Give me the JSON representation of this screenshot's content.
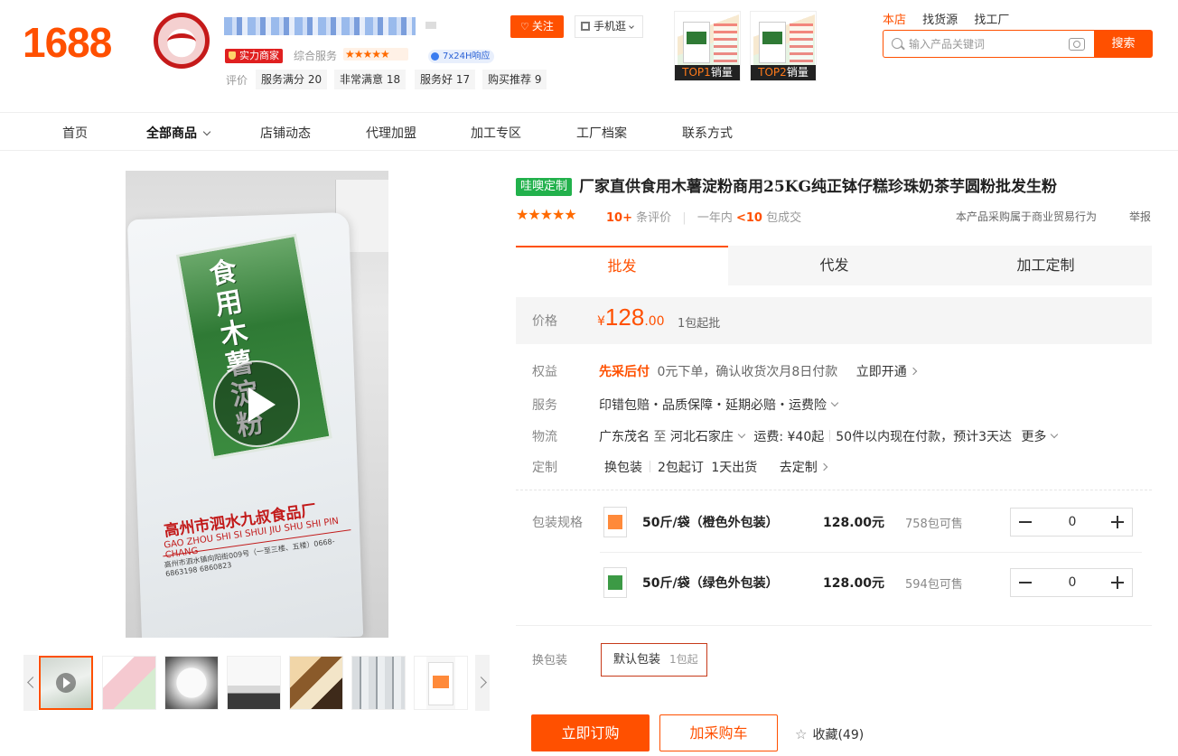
{
  "header": {
    "logo": "1688",
    "badge_power": "实力商家",
    "service_label": "综合服务",
    "service_stars": "★★★★★",
    "response_badge": "7x24H响应",
    "rating_label": "评价",
    "ratings": [
      {
        "label": "服务满分",
        "value": "20"
      },
      {
        "label": "非常满意",
        "value": "18"
      },
      {
        "label": "服务好",
        "value": "17"
      },
      {
        "label": "购买推荐",
        "value": "9"
      }
    ],
    "follow_label": "关注",
    "mobile_label": "手机逛",
    "top_items": [
      {
        "rank": "TOP1",
        "tag": "销量"
      },
      {
        "rank": "TOP2",
        "tag": "销量"
      }
    ],
    "search_tabs": [
      "本店",
      "找货源",
      "找工厂"
    ],
    "search_placeholder": "输入产品关键词",
    "search_button": "搜索"
  },
  "nav": {
    "items": [
      "首页",
      "全部商品",
      "店铺动态",
      "代理加盟",
      "加工专区",
      "工厂档案",
      "联系方式"
    ]
  },
  "gallery": {
    "main_image_text": {
      "title": "食用木薯淀粉",
      "maker": "高州市泗水九叔食品厂",
      "pinyin": "GAO ZHOU SHI SI SHUI JIU SHU SHI PIN CHANG",
      "address": "高州市泗水镇向阳街009号（一至三楼、五楼）0668-6863198 6860823"
    },
    "thumbnails": 7
  },
  "product": {
    "badge": "哇噢定制",
    "title": "厂家直供食用木薯淀粉商用25KG纯正钵仔糕珍珠奶茶芋圆粉批发生粉",
    "stars": "★★★★★",
    "review_count": "10+",
    "review_label": "条评价",
    "sold_prefix": "一年内",
    "sold_count": "<10",
    "sold_suffix": "包成交",
    "biz_note": "本产品采购属于商业贸易行为",
    "report": "举报",
    "tabs": [
      "批发",
      "代发",
      "加工定制"
    ],
    "price_label": "价格",
    "currency": "¥",
    "price_int": "128",
    "price_dec": ".00",
    "moq": "1包起批",
    "rows": {
      "rights_label": "权益",
      "rights_tag": "先采后付",
      "rights_text": "0元下单，确认收货次月8日付款",
      "rights_link": "立即开通",
      "service_label": "服务",
      "service_text": "印错包赔・品质保障・延期必赔・运费险",
      "logistics_label": "物流",
      "logistics_from": "广东茂名",
      "logistics_to_word": "至",
      "logistics_to": "河北石家庄",
      "shipping_fee": "运费: ¥40起",
      "delivery": "50件以内现在付款，预计3天达",
      "more": "更多",
      "custom_label": "定制",
      "custom_opt": "换包装",
      "custom_moq": "2包起订",
      "custom_days": "1天出货",
      "custom_link": "去定制"
    },
    "sku_label": "包装规格",
    "skus": [
      {
        "name": "50斤/袋（橙色外包装）",
        "price": "128.00元",
        "stock": "758包可售",
        "qty": "0"
      },
      {
        "name": "50斤/袋（绿色外包装）",
        "price": "128.00元",
        "stock": "594包可售",
        "qty": "0"
      }
    ],
    "pack_label": "换包装",
    "pack_option": "默认包装",
    "pack_moq": "1包起",
    "buy_label": "立即订购",
    "cart_label": "加采购车",
    "fav_label": "收藏(49)"
  }
}
